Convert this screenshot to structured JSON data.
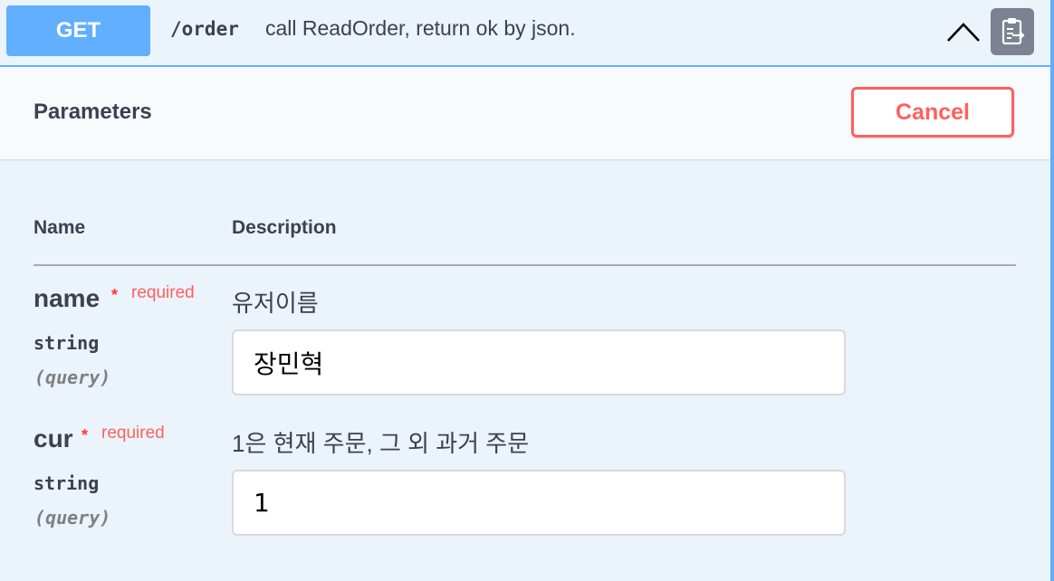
{
  "summary": {
    "method": "GET",
    "path": "/order",
    "description": "call ReadOrder, return ok by json.",
    "collapse_icon": "chevron-up-icon",
    "copy_icon": "clipboard-copy-icon"
  },
  "parameters": {
    "title": "Parameters",
    "cancel_label": "Cancel",
    "columns": {
      "name": "Name",
      "description": "Description"
    },
    "items": [
      {
        "name": "name",
        "required_star": "*",
        "required_label": "required",
        "type": "string",
        "in": "(query)",
        "description": "유저이름",
        "value": "장민혁"
      },
      {
        "name": "cur",
        "required_star": "*",
        "required_label": "required",
        "type": "string",
        "in": "(query)",
        "description": "1은 현재 주문, 그 외 과거 주문",
        "value": "1"
      }
    ]
  },
  "colors": {
    "get_method": "#61affe",
    "block_background": "#ebf3fb",
    "cancel_red": "#ff6060",
    "text": "#3b4151"
  }
}
